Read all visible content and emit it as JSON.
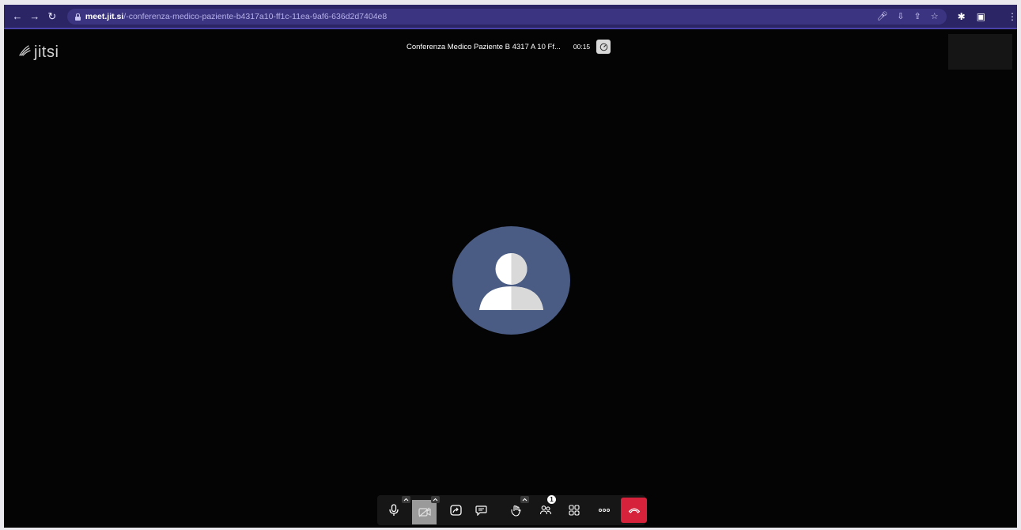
{
  "browser": {
    "url_host": "meet.jit.si",
    "url_path": "/-conferenza-medico-paziente-b4317a10-ff1c-11ea-9af6-636d2d7404e8"
  },
  "brand": {
    "logo_text": "jitsi"
  },
  "conference": {
    "subject": "Conferenza Medico Paziente B 4317 A 10 Ff...",
    "timer": "00:15"
  },
  "toolbar": {
    "participants_count": "1",
    "hangup_color": "#d6223a"
  },
  "colors": {
    "avatar_bg": "#4a5c84",
    "stage_bg": "#040404",
    "browser_bar": "#2b2566"
  }
}
